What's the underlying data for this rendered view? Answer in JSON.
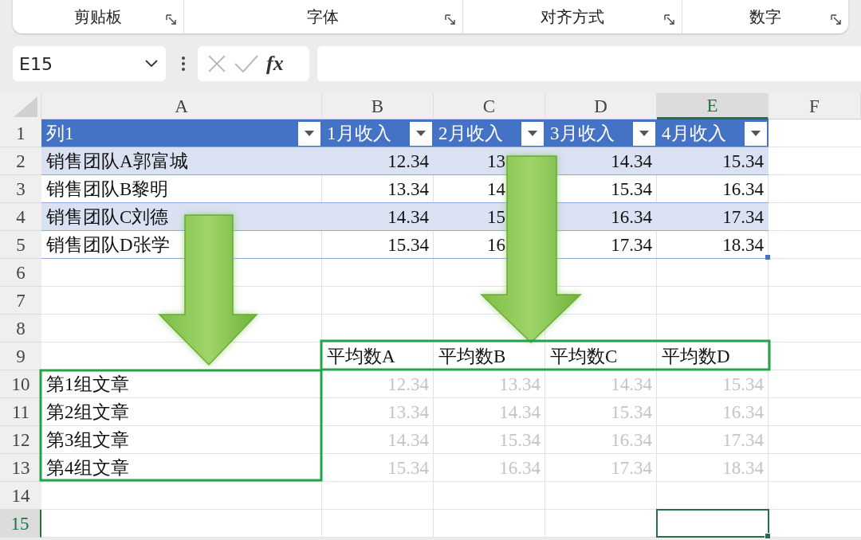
{
  "ribbon_groups": [
    {
      "label": "剪贴板"
    },
    {
      "label": "字体"
    },
    {
      "label": "对齐方式"
    },
    {
      "label": "数字"
    }
  ],
  "name_box": {
    "value": "E15"
  },
  "formula_bar": {
    "function_label": "fx"
  },
  "columns": [
    {
      "label": "A",
      "selected": false
    },
    {
      "label": "B",
      "selected": false
    },
    {
      "label": "C",
      "selected": false
    },
    {
      "label": "D",
      "selected": false
    },
    {
      "label": "E",
      "selected": true
    },
    {
      "label": "F",
      "selected": false
    }
  ],
  "rows": [
    {
      "number": "1",
      "selected": false,
      "kind": "table_header",
      "cells": [
        {
          "text": "列1"
        },
        {
          "text": "1月收入"
        },
        {
          "text": "2月收入"
        },
        {
          "text": "3月收入"
        },
        {
          "text": "4月收入"
        }
      ]
    },
    {
      "number": "2",
      "selected": false,
      "kind": "table_row",
      "banded": true,
      "cells": [
        {
          "text": "销售团队A郭富城",
          "covered": false
        },
        {
          "text": "12.34",
          "covered": false
        },
        {
          "text": "13",
          "covered": true
        },
        {
          "text": "14.34",
          "covered": false
        },
        {
          "text": "15.34",
          "covered": false
        }
      ]
    },
    {
      "number": "3",
      "selected": false,
      "kind": "table_row",
      "banded": false,
      "cells": [
        {
          "text": "销售团队B黎明",
          "covered": false
        },
        {
          "text": "13.34",
          "covered": false
        },
        {
          "text": "14",
          "covered": true
        },
        {
          "text": "15.34",
          "covered": false
        },
        {
          "text": "16.34",
          "covered": false
        }
      ]
    },
    {
      "number": "4",
      "selected": false,
      "kind": "table_row",
      "banded": true,
      "cells": [
        {
          "text": "销售团队C刘德",
          "covered": false
        },
        {
          "text": "14.34",
          "covered": false
        },
        {
          "text": "15",
          "covered": true
        },
        {
          "text": "16.34",
          "covered": false
        },
        {
          "text": "17.34",
          "covered": false
        }
      ]
    },
    {
      "number": "5",
      "selected": false,
      "kind": "table_row",
      "banded": false,
      "cells": [
        {
          "text": "销售团队D张学",
          "covered": false
        },
        {
          "text": "15.34",
          "covered": false
        },
        {
          "text": "16",
          "covered": true
        },
        {
          "text": "17.34",
          "covered": false
        },
        {
          "text": "18.34",
          "covered": false
        }
      ]
    },
    {
      "number": "6",
      "selected": false,
      "kind": "empty",
      "cells": []
    },
    {
      "number": "7",
      "selected": false,
      "kind": "empty",
      "cells": []
    },
    {
      "number": "8",
      "selected": false,
      "kind": "empty",
      "cells": []
    },
    {
      "number": "9",
      "selected": false,
      "kind": "average_header",
      "cells": [
        {
          "text": "平均数A"
        },
        {
          "text": "平均数B"
        },
        {
          "text": "平均数C"
        },
        {
          "text": "平均数D"
        }
      ]
    },
    {
      "number": "10",
      "selected": false,
      "kind": "result_row",
      "cells": [
        {
          "text": "第1组文章"
        },
        {
          "text": "12.34"
        },
        {
          "text": "13.34"
        },
        {
          "text": "14.34"
        },
        {
          "text": "15.34"
        }
      ]
    },
    {
      "number": "11",
      "selected": false,
      "kind": "result_row",
      "cells": [
        {
          "text": "第2组文章"
        },
        {
          "text": "13.34"
        },
        {
          "text": "14.34"
        },
        {
          "text": "15.34"
        },
        {
          "text": "16.34"
        }
      ]
    },
    {
      "number": "12",
      "selected": false,
      "kind": "result_row",
      "cells": [
        {
          "text": "第3组文章"
        },
        {
          "text": "14.34"
        },
        {
          "text": "15.34"
        },
        {
          "text": "16.34"
        },
        {
          "text": "17.34"
        }
      ]
    },
    {
      "number": "13",
      "selected": false,
      "kind": "result_row",
      "cells": [
        {
          "text": "第4组文章"
        },
        {
          "text": "15.34"
        },
        {
          "text": "16.34"
        },
        {
          "text": "17.34"
        },
        {
          "text": "18.34"
        }
      ]
    },
    {
      "number": "14",
      "selected": false,
      "kind": "empty",
      "cells": []
    },
    {
      "number": "15",
      "selected": true,
      "kind": "empty",
      "cells": []
    }
  ]
}
